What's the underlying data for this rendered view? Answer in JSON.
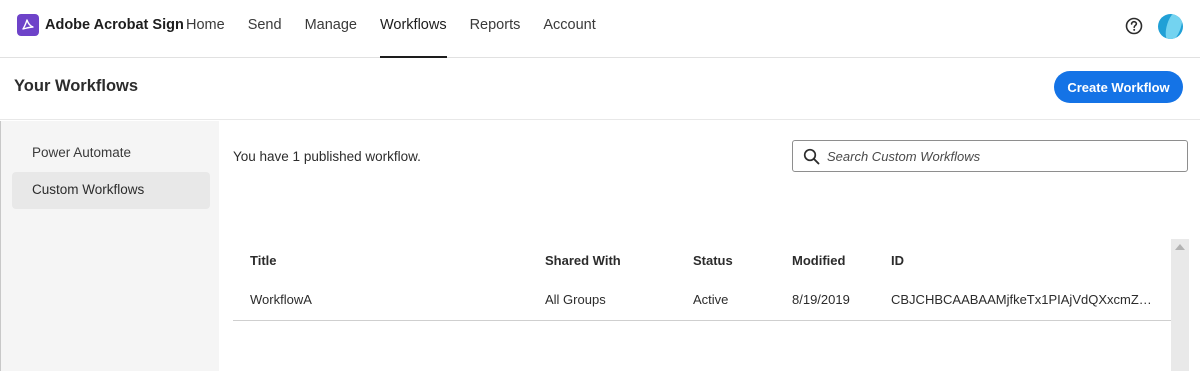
{
  "header": {
    "brand": "Adobe Acrobat Sign",
    "nav": [
      "Home",
      "Send",
      "Manage",
      "Workflows",
      "Reports",
      "Account"
    ],
    "active_nav": "Workflows"
  },
  "page": {
    "title": "Your Workflows",
    "create_button": "Create Workflow"
  },
  "sidebar": {
    "items": [
      {
        "label": "Power Automate",
        "selected": false
      },
      {
        "label": "Custom Workflows",
        "selected": true
      }
    ]
  },
  "main": {
    "count_text": "You have 1 published workflow.",
    "search_placeholder": "Search Custom Workflows",
    "table": {
      "columns": [
        "Title",
        "Shared With",
        "Status",
        "Modified",
        "ID"
      ],
      "rows": [
        [
          "WorkflowA",
          "All Groups",
          "Active",
          "8/19/2019",
          "CBJCHBCAABAAMjfkeTx1PIAjVdQXxcmZvEW..."
        ]
      ]
    }
  },
  "colors": {
    "accent": "#1473e6",
    "logo": "#6e43c9",
    "sidebar_bg": "#f5f5f5"
  },
  "icons": [
    "acrobat-logo-icon",
    "help-icon",
    "avatar",
    "search-icon"
  ]
}
